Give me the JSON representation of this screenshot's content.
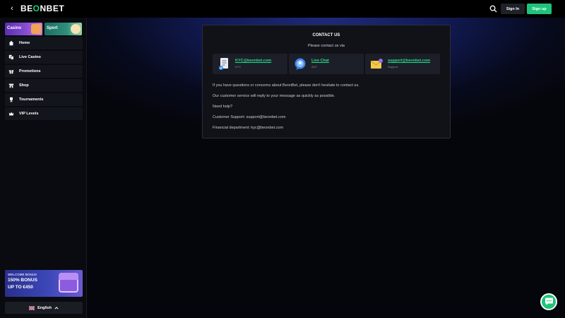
{
  "header": {
    "logo_left": "BE",
    "logo_accent": "O",
    "logo_right": "NBET",
    "signin_label": "Sign In",
    "signup_label": "Sign up",
    "accent_color": "#1ec47a"
  },
  "sidebar": {
    "categories": [
      {
        "label": "Casino"
      },
      {
        "label": "Sport"
      }
    ],
    "items": [
      {
        "label": "Home",
        "icon": "home-icon"
      },
      {
        "label": "Live Casino",
        "icon": "live-casino-icon"
      },
      {
        "label": "Promotions",
        "icon": "gift-icon"
      },
      {
        "label": "Shop",
        "icon": "shop-icon"
      },
      {
        "label": "Tournaments",
        "icon": "trophy-icon"
      },
      {
        "label": "VIP Levels",
        "icon": "crown-icon"
      }
    ],
    "bonus": {
      "small": "WELCOME BONUS",
      "line1": "150% BONUS",
      "line2": "UP TO €450"
    },
    "language": "English"
  },
  "contact": {
    "title": "CONTACT US",
    "subtitle": "Please contact us via",
    "methods": [
      {
        "label": "KYC@beonbet.com",
        "sub": "KYC"
      },
      {
        "label": "Live Chat",
        "sub": "24/7"
      },
      {
        "label": "support@beonbet.com",
        "sub": "Support"
      }
    ],
    "text1": "If you have questions or concerns about BeonBet, please don't hesitate to contact us.",
    "text2": "Our customer service will reply to your message as quickly as possible.",
    "text3": "Need help?",
    "text4": "Customer Support: support@beonbet.com",
    "text5": "Financial department: kyc@beonbet.com"
  }
}
